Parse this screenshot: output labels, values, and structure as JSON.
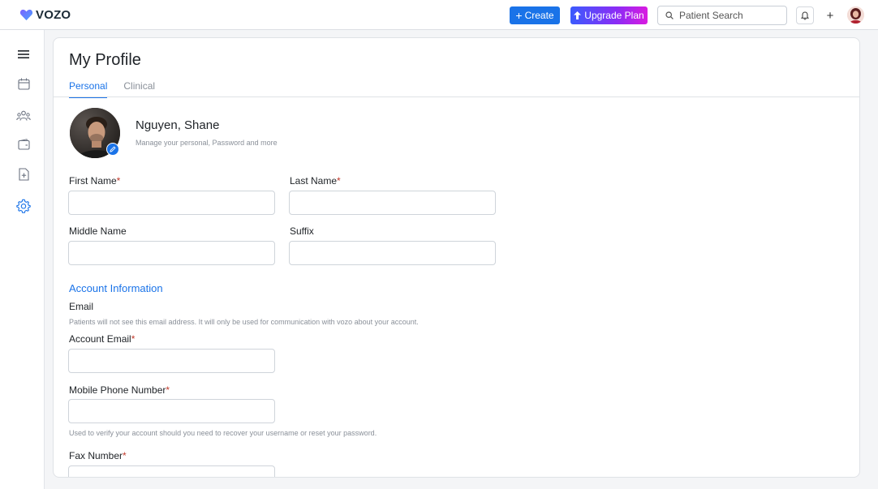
{
  "topbar": {
    "logo_text": "VOZO",
    "create_label": "Create",
    "upgrade_label": "Upgrade Plan",
    "search_placeholder": "Patient Search",
    "plus_label": "+"
  },
  "sidebar": {
    "items": [
      "menu-icon",
      "calendar-icon",
      "patients-icon",
      "wallet-icon",
      "document-add-icon",
      "settings-icon"
    ]
  },
  "profile": {
    "page_title": "My Profile",
    "tabs": [
      {
        "label": "Personal",
        "active": true
      },
      {
        "label": "Clinical",
        "active": false
      }
    ],
    "name": "Nguyen, Shane",
    "subtitle": "Manage your personal, Password and more"
  },
  "form": {
    "first_name_label": "First Name",
    "last_name_label": "Last Name",
    "middle_name_label": "Middle Name",
    "suffix_label": "Suffix",
    "required_mark": "*",
    "account_section_title": "Account Information",
    "email_label": "Email",
    "email_helper": "Patients will not see this email address. It will only be used for communication with vozo about your account.",
    "account_email_label": "Account Email",
    "mobile_label": "Mobile Phone Number",
    "mobile_helper": "Used to verify your account should you need to recover your username or reset your password.",
    "fax_label": "Fax Number"
  },
  "colors": {
    "accent": "#1a73e8",
    "required": "#c0392b",
    "logo_heart": "#6c5ce7"
  }
}
